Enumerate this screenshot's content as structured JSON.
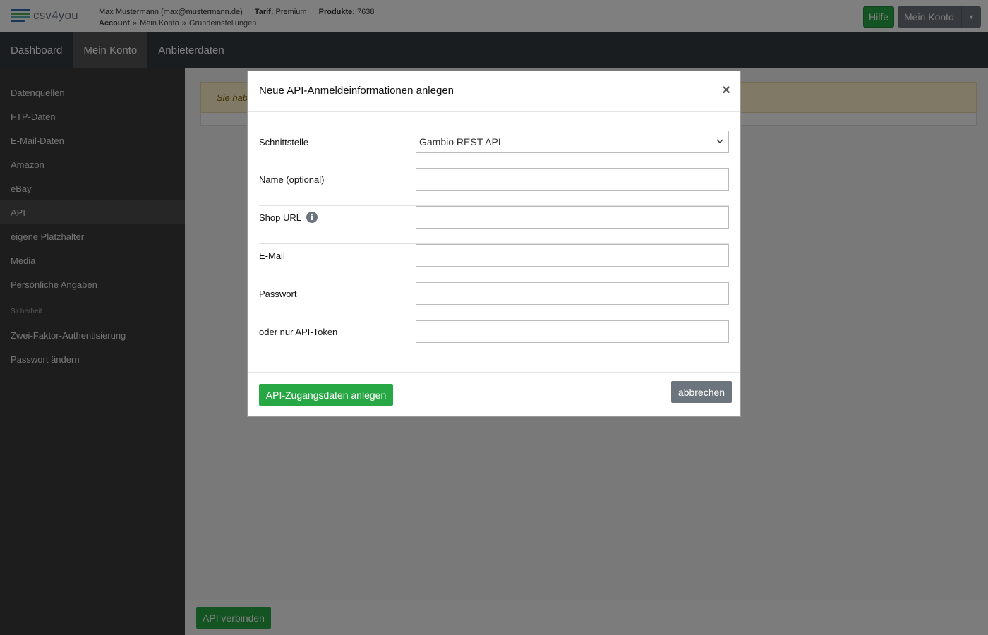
{
  "header": {
    "logo_text": "csv4you",
    "user": "Max Mustermann (max@mustermann.de)",
    "tarif_label": "Tarif:",
    "tarif_value": "Premium",
    "produkte_label": "Produkte:",
    "produkte_value": "7638",
    "breadcrumb": [
      "Account",
      "Mein Konto",
      "Grundeinstellungen"
    ],
    "breadcrumb_sep": "»",
    "help_label": "Hilfe",
    "account_label": "Mein Konto",
    "account_caret": "▼"
  },
  "nav": {
    "items": [
      {
        "label": "Dashboard",
        "active": false
      },
      {
        "label": "Mein Konto",
        "active": true
      },
      {
        "label": "Anbieterdaten",
        "active": false
      }
    ]
  },
  "sidebar": {
    "items": [
      "Datenquellen",
      "FTP-Daten",
      "E-Mail-Daten",
      "Amazon",
      "eBay",
      "API",
      "eigene Platzhalter",
      "Media",
      "Persönliche Angaben"
    ],
    "active": "API",
    "section_heading": "Sicherheit",
    "security_items": [
      "Zwei-Faktor-Authentisierung",
      "Passwort ändern"
    ]
  },
  "content": {
    "alert_text": "Sie hab",
    "connect_button": "API verbinden"
  },
  "modal": {
    "title": "Neue API-Anmeldeinformationen anlegen",
    "close": "×",
    "fields": {
      "schnittstelle_label": "Schnittstelle",
      "schnittstelle_value": "Gambio REST API",
      "name_label": "Name (optional)",
      "name_value": "",
      "shop_url_label": "Shop URL",
      "shop_url_value": "",
      "email_label": "E-Mail",
      "email_value": "",
      "passwort_label": "Passwort",
      "passwort_value": "",
      "token_label": "oder nur API-Token",
      "token_value": ""
    },
    "info_glyph": "i",
    "submit_label": "API-Zugangsdaten anlegen",
    "cancel_label": "abbrechen"
  },
  "colors": {
    "green": "#28a745",
    "gray": "#6c757d",
    "navbar": "#343a40",
    "sidebar": "#3b3b3b",
    "logo_blue": "#2d6fb5",
    "logo_green": "#4caf50",
    "logo_teal": "#5ab4b0"
  },
  "icons": {
    "logo": "csv4you-logo-icon",
    "info": "info-circle-icon",
    "close": "close-icon",
    "select": "chevron-down-icon",
    "caret": "caret-down-icon"
  }
}
